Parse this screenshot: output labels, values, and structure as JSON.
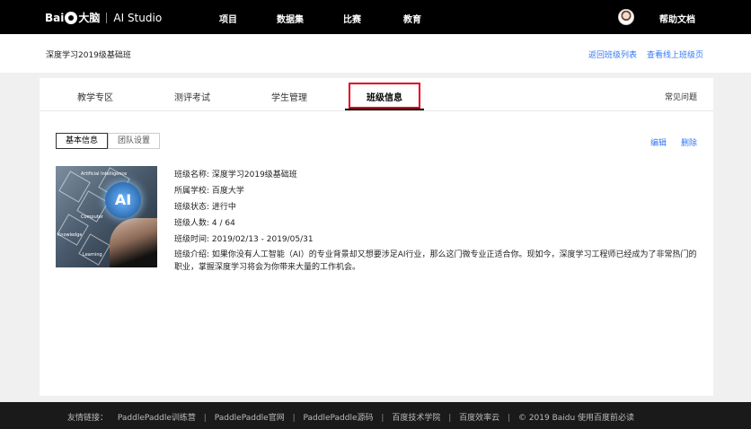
{
  "header": {
    "brand": "Bai",
    "brand_cn": "大脑",
    "product": "AI Studio",
    "nav": [
      "项目",
      "数据集",
      "比赛",
      "教育"
    ],
    "help": "帮助文档"
  },
  "classbar": {
    "title": "深度学习2019级基础班",
    "back_link": "返回班级列表",
    "view_link": "查看线上班级页"
  },
  "tabs": {
    "items": [
      "教学专区",
      "测评考试",
      "学生管理",
      "班级信息"
    ],
    "active": "班级信息",
    "faq": "常见问题"
  },
  "subtabs": {
    "basic": "基本信息",
    "team": "团队设置"
  },
  "actions": {
    "edit": "编辑",
    "delete": "删除"
  },
  "thumbnail": {
    "badge": "AI",
    "labels": [
      "Artificial Intelligence",
      "Computer",
      "Knowledge",
      "Learning"
    ]
  },
  "info": {
    "name": "班级名称: 深度学习2019级基础班",
    "school": "所属学校: 百度大学",
    "status": "班级状态: 进行中",
    "count": "班级人数: 4 / 64",
    "time": "班级时间: 2019/02/13 - 2019/05/31",
    "intro": "班级介绍: 如果你没有人工智能（AI）的专业背景却又想要涉足AI行业，那么这门微专业正适合你。现如今，深度学习工程师已经成为了非常热门的职业，掌握深度学习将会为你带来大量的工作机会。"
  },
  "footer": {
    "label": "友情链接：",
    "links": [
      "PaddlePaddle训练营",
      "PaddlePaddle官网",
      "PaddlePaddle源码",
      "百度技术学院",
      "百度效率云"
    ],
    "copyright": "© 2019 Baidu 使用百度前必读"
  }
}
